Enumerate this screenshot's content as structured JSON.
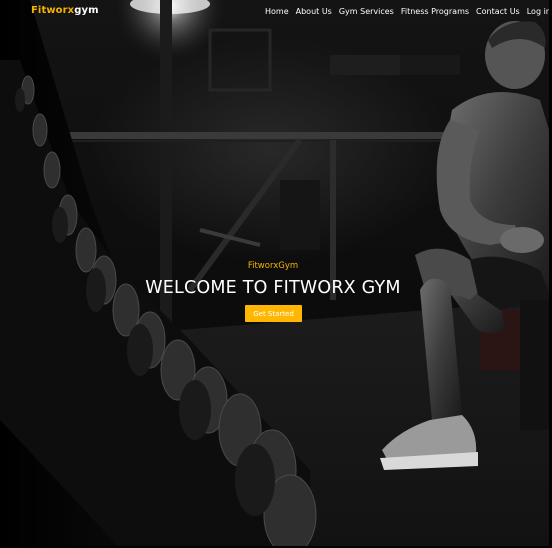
{
  "navbar": {
    "brand_part1": "Fitworx",
    "brand_part2": "gym",
    "links": [
      {
        "label": "Home"
      },
      {
        "label": "About Us"
      },
      {
        "label": "Gym Services"
      },
      {
        "label": "Fitness Programs"
      },
      {
        "label": "Contact Us"
      },
      {
        "label": "Log in"
      }
    ]
  },
  "hero": {
    "subtitle": "FitworxGym",
    "title": "WELCOME TO FITWORX GYM",
    "cta_label": "Get Started"
  },
  "theme": {
    "accent": "#f5b400",
    "button": "#ffb703",
    "text": "#ffffff",
    "background": "#0a0a0a"
  }
}
